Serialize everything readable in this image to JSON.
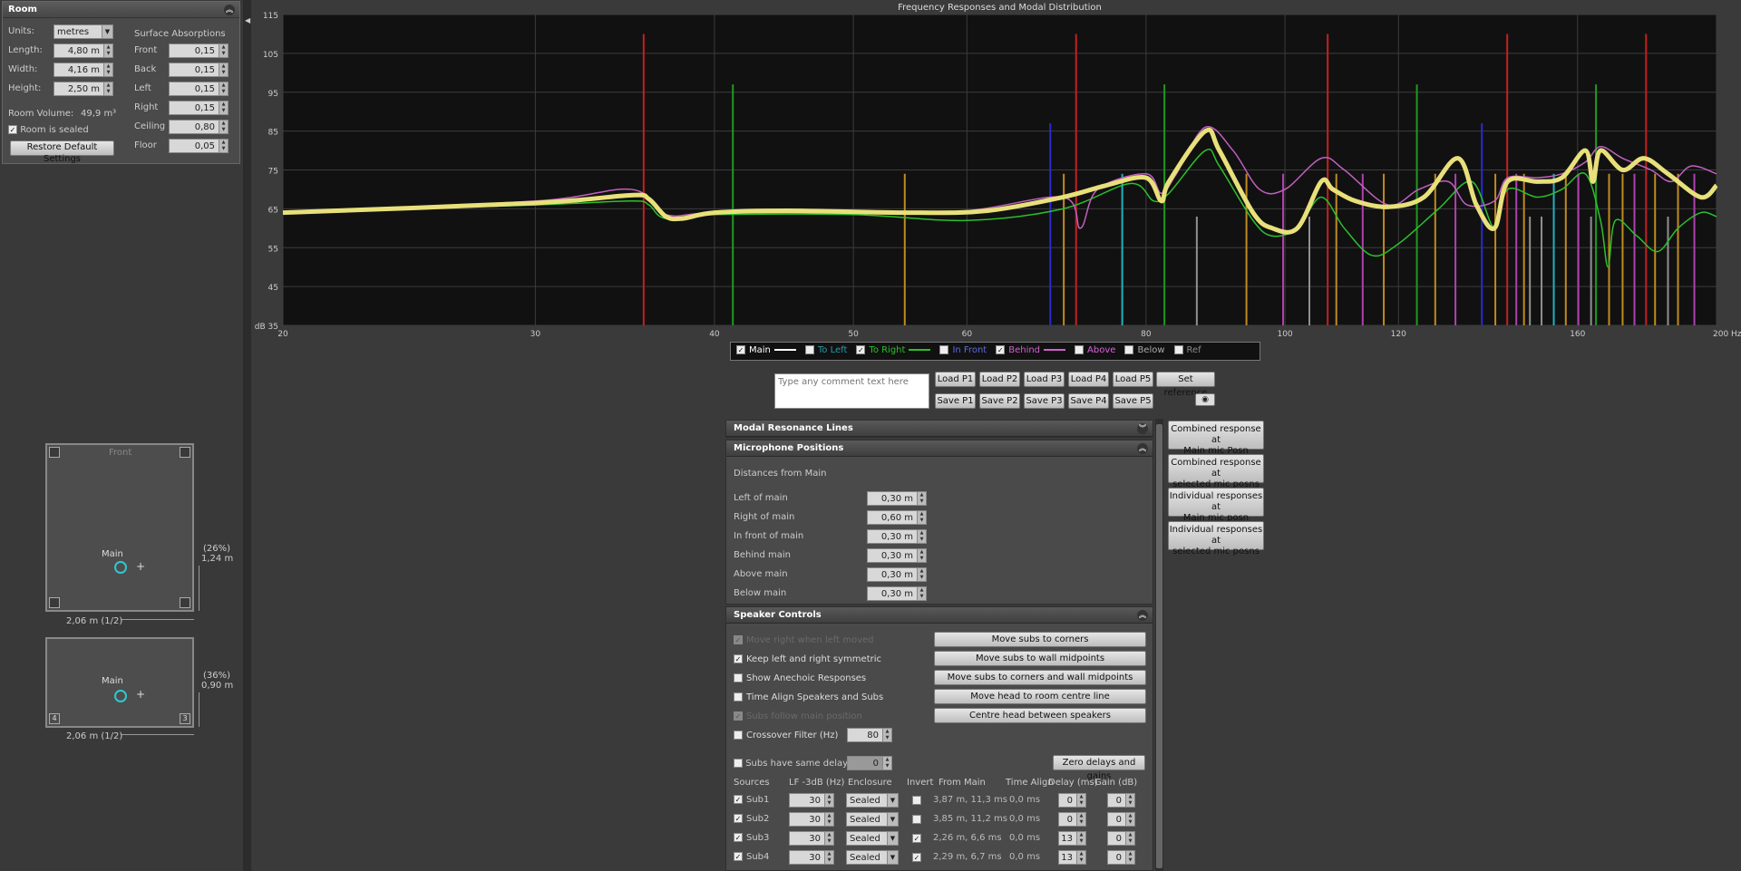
{
  "room": {
    "title": "Room",
    "units_label": "Units:",
    "units_value": "metres",
    "length_label": "Length:",
    "length_value": "4,80 m",
    "width_label": "Width:",
    "width_value": "4,16 m",
    "height_label": "Height:",
    "height_value": "2,50 m",
    "volume_label": "Room Volume:",
    "volume_value": "49,9 m³",
    "sealed_label": "Room is sealed",
    "restore_label": "Restore Default Settings",
    "surface_title": "Surface Absorptions",
    "surfaces": [
      {
        "label": "Front",
        "value": "0,15"
      },
      {
        "label": "Back",
        "value": "0,15"
      },
      {
        "label": "Left",
        "value": "0,15"
      },
      {
        "label": "Right",
        "value": "0,15"
      },
      {
        "label": "Ceiling",
        "value": "0,80"
      },
      {
        "label": "Floor",
        "value": "0,05"
      }
    ]
  },
  "plan_top": {
    "front_label": "Front",
    "main_label": "Main",
    "side_pct": "(26%)",
    "side_dist": "1,24 m",
    "bottom_dist": "2,06 m (1/2)"
  },
  "plan_side": {
    "main_label": "Main",
    "side_pct": "(36%)",
    "side_dist": "0,90 m",
    "bottom_dist": "2,06 m (1/2)",
    "corner_left": "4",
    "corner_right": "3"
  },
  "chart_data": {
    "type": "line",
    "title": "Frequency Responses and Modal Distribution",
    "xscale": "log",
    "xlim": [
      20,
      200
    ],
    "ylim": [
      35,
      115
    ],
    "xticks": [
      "20",
      "30",
      "40",
      "50",
      "60",
      "80",
      "100",
      "120",
      "160",
      "200 Hz"
    ],
    "xtick_values": [
      20,
      30,
      40,
      50,
      60,
      80,
      100,
      120,
      160,
      200
    ],
    "yticks": [
      "115",
      "105",
      "95",
      "85",
      "75",
      "65",
      "55",
      "45",
      "dB 35"
    ],
    "ytick_values": [
      115,
      105,
      95,
      85,
      75,
      65,
      55,
      45,
      35
    ],
    "grid": true,
    "series": [
      {
        "name": "Main",
        "color": "#e8e07a",
        "points": [
          [
            20,
            64
          ],
          [
            30,
            66.5
          ],
          [
            35,
            68.5
          ],
          [
            36,
            67.5
          ],
          [
            37,
            63
          ],
          [
            38,
            62.5
          ],
          [
            40,
            64
          ],
          [
            45,
            64.5
          ],
          [
            55,
            64
          ],
          [
            62,
            64.5
          ],
          [
            70,
            68
          ],
          [
            75,
            71
          ],
          [
            80,
            73
          ],
          [
            82,
            67
          ],
          [
            83,
            72
          ],
          [
            88,
            85
          ],
          [
            90,
            80
          ],
          [
            95,
            64
          ],
          [
            98,
            60
          ],
          [
            102,
            60
          ],
          [
            106,
            72
          ],
          [
            108,
            70
          ],
          [
            112,
            67
          ],
          [
            118,
            65.5
          ],
          [
            125,
            68
          ],
          [
            132,
            78
          ],
          [
            136,
            66
          ],
          [
            140,
            60
          ],
          [
            143,
            72
          ],
          [
            150,
            72
          ],
          [
            156,
            73
          ],
          [
            162,
            80
          ],
          [
            164,
            72
          ],
          [
            166,
            80
          ],
          [
            172,
            75
          ],
          [
            178,
            78
          ],
          [
            185,
            74
          ],
          [
            195,
            68
          ],
          [
            200,
            71
          ]
        ]
      },
      {
        "name": "To Right",
        "color": "#2cc02c",
        "points": [
          [
            20,
            64
          ],
          [
            30,
            66
          ],
          [
            35,
            67
          ],
          [
            36,
            66
          ],
          [
            37,
            62.5
          ],
          [
            40,
            63.5
          ],
          [
            50,
            63.5
          ],
          [
            60,
            62
          ],
          [
            70,
            65
          ],
          [
            78,
            71.5
          ],
          [
            81,
            67
          ],
          [
            83,
            69
          ],
          [
            88,
            80
          ],
          [
            90,
            76
          ],
          [
            95,
            62
          ],
          [
            98,
            58
          ],
          [
            102,
            60
          ],
          [
            106,
            68
          ],
          [
            110,
            60
          ],
          [
            115,
            53
          ],
          [
            120,
            56
          ],
          [
            128,
            65
          ],
          [
            135,
            72
          ],
          [
            140,
            60
          ],
          [
            143,
            70
          ],
          [
            150,
            68
          ],
          [
            156,
            70
          ],
          [
            162,
            74
          ],
          [
            166,
            62
          ],
          [
            168,
            50
          ],
          [
            170,
            62
          ],
          [
            176,
            58
          ],
          [
            182,
            54
          ],
          [
            188,
            60
          ],
          [
            195,
            64
          ],
          [
            200,
            63
          ]
        ]
      },
      {
        "name": "Behind",
        "color": "#c060c0",
        "points": [
          [
            20,
            64
          ],
          [
            30,
            67
          ],
          [
            35,
            70
          ],
          [
            37,
            63.5
          ],
          [
            40,
            64
          ],
          [
            50,
            64
          ],
          [
            60,
            64.5
          ],
          [
            70,
            68
          ],
          [
            72,
            60
          ],
          [
            74,
            70
          ],
          [
            80,
            74
          ],
          [
            82,
            69
          ],
          [
            84,
            74
          ],
          [
            88,
            86
          ],
          [
            92,
            80
          ],
          [
            96,
            70
          ],
          [
            100,
            70
          ],
          [
            106,
            78
          ],
          [
            110,
            75
          ],
          [
            118,
            66
          ],
          [
            124,
            70
          ],
          [
            130,
            72
          ],
          [
            134,
            66
          ],
          [
            140,
            67
          ],
          [
            143,
            73
          ],
          [
            150,
            73
          ],
          [
            156,
            74
          ],
          [
            162,
            77
          ],
          [
            166,
            81
          ],
          [
            172,
            78
          ],
          [
            180,
            75
          ],
          [
            186,
            72
          ],
          [
            192,
            76
          ],
          [
            200,
            74
          ]
        ]
      }
    ],
    "mode_lines": [
      {
        "f": 35.7,
        "color": "#c42020",
        "top": 110
      },
      {
        "f": 71.5,
        "color": "#c42020",
        "top": 110
      },
      {
        "f": 107.1,
        "color": "#c42020",
        "top": 110
      },
      {
        "f": 142.9,
        "color": "#c42020",
        "top": 110
      },
      {
        "f": 178.6,
        "color": "#c42020",
        "top": 110
      },
      {
        "f": 41.2,
        "color": "#1f9a1f",
        "top": 97
      },
      {
        "f": 82.4,
        "color": "#1f9a1f",
        "top": 97
      },
      {
        "f": 123.6,
        "color": "#1f9a1f",
        "top": 97
      },
      {
        "f": 164.8,
        "color": "#1f9a1f",
        "top": 97
      },
      {
        "f": 54.3,
        "color": "#c08a20",
        "top": 74
      },
      {
        "f": 70.1,
        "color": "#c08a20",
        "top": 74
      },
      {
        "f": 94.0,
        "color": "#c08a20",
        "top": 74
      },
      {
        "f": 108.6,
        "color": "#c08a20",
        "top": 74
      },
      {
        "f": 117.2,
        "color": "#c08a20",
        "top": 74
      },
      {
        "f": 127.3,
        "color": "#c08a20",
        "top": 74
      },
      {
        "f": 140.2,
        "color": "#c08a20",
        "top": 74
      },
      {
        "f": 146.8,
        "color": "#c08a20",
        "top": 74
      },
      {
        "f": 157.0,
        "color": "#c08a20",
        "top": 74
      },
      {
        "f": 168.3,
        "color": "#c08a20",
        "top": 74
      },
      {
        "f": 172.0,
        "color": "#c08a20",
        "top": 74
      },
      {
        "f": 181.2,
        "color": "#c08a20",
        "top": 74
      },
      {
        "f": 188.0,
        "color": "#c08a20",
        "top": 74
      },
      {
        "f": 68.6,
        "color": "#2a2ad0",
        "top": 87
      },
      {
        "f": 137.2,
        "color": "#2a2ad0",
        "top": 87
      },
      {
        "f": 77.0,
        "color": "#20b0c0",
        "top": 74
      },
      {
        "f": 154.0,
        "color": "#20b0c0",
        "top": 74
      },
      {
        "f": 99.7,
        "color": "#b040b0",
        "top": 74
      },
      {
        "f": 113.3,
        "color": "#b040b0",
        "top": 74
      },
      {
        "f": 131.5,
        "color": "#b040b0",
        "top": 74
      },
      {
        "f": 145.0,
        "color": "#b040b0",
        "top": 74
      },
      {
        "f": 160.2,
        "color": "#b040b0",
        "top": 74
      },
      {
        "f": 175.3,
        "color": "#b040b0",
        "top": 74
      },
      {
        "f": 193.0,
        "color": "#b040b0",
        "top": 74
      },
      {
        "f": 86.8,
        "color": "#909090",
        "top": 63
      },
      {
        "f": 104.0,
        "color": "#909090",
        "top": 63
      },
      {
        "f": 148.2,
        "color": "#909090",
        "top": 63
      },
      {
        "f": 151.0,
        "color": "#909090",
        "top": 63
      },
      {
        "f": 163.5,
        "color": "#909090",
        "top": 63
      },
      {
        "f": 185.0,
        "color": "#909090",
        "top": 63
      }
    ]
  },
  "legend": [
    {
      "label": "Main",
      "checked": true,
      "color": "#ffffff",
      "line": true
    },
    {
      "label": "To Left",
      "checked": false,
      "color": "#2a9aaa",
      "line": false
    },
    {
      "label": "To Right",
      "checked": true,
      "color": "#2cc02c",
      "line": true
    },
    {
      "label": "In Front",
      "checked": false,
      "color": "#5a6ae0",
      "line": false
    },
    {
      "label": "Behind",
      "checked": true,
      "color": "#d060d0",
      "line": true
    },
    {
      "label": "Above",
      "checked": false,
      "color": "#e060e0",
      "line": false
    },
    {
      "label": "Below",
      "checked": false,
      "color": "#aaaaaa",
      "line": false
    },
    {
      "label": "Ref",
      "checked": false,
      "color": "#888888",
      "line": false
    }
  ],
  "comment_placeholder": "Type any comment text here",
  "load_buttons": [
    "Load P1",
    "Load P2",
    "Load P3",
    "Load P4",
    "Load P5"
  ],
  "save_buttons": [
    "Save P1",
    "Save P2",
    "Save P3",
    "Save P4",
    "Save P5"
  ],
  "set_reference": "Set reference",
  "modal_panel_title": "Modal Resonance Lines",
  "mic_panel": {
    "title": "Microphone Positions",
    "subtitle": "Distances from Main",
    "rows": [
      {
        "label": "Left of main",
        "value": "0,30 m"
      },
      {
        "label": "Right of main",
        "value": "0,60 m"
      },
      {
        "label": "In front of main",
        "value": "0,30 m"
      },
      {
        "label": "Behind main",
        "value": "0,30 m"
      },
      {
        "label": "Above main",
        "value": "0,30 m"
      },
      {
        "label": "Below main",
        "value": "0,30 m"
      }
    ]
  },
  "side_buttons": [
    "Combined response at\nMain mic Posn",
    "Combined response at\nselected mic posns",
    "Individual responses at\nMain mic posn",
    "Individual responses at\nselected mic posns"
  ],
  "speaker_panel": {
    "title": "Speaker Controls",
    "checks": [
      {
        "label": "Move right when left moved",
        "checked": true,
        "disabled": true
      },
      {
        "label": "Keep left and right symmetric",
        "checked": true,
        "disabled": false
      },
      {
        "label": "Show Anechoic Responses",
        "checked": false,
        "disabled": false
      },
      {
        "label": "Time Align Speakers and Subs",
        "checked": false,
        "disabled": false
      },
      {
        "label": "Subs follow main position",
        "checked": true,
        "disabled": true
      },
      {
        "label": "Crossover Filter (Hz)",
        "checked": false,
        "disabled": false
      }
    ],
    "crossover_value": "80",
    "action_buttons": [
      "Move subs to corners",
      "Move subs to wall midpoints",
      "Move subs to corners and wall midpoints",
      "Move head to room centre line",
      "Centre head between speakers"
    ],
    "same_delay_label": "Subs have same delay",
    "same_delay_value": "0",
    "zero_button": "Zero delays and gains",
    "columns": [
      "Sources",
      "LF -3dB (Hz)",
      "Enclosure",
      "Invert",
      "From Main",
      "Time Align",
      "Delay (ms)",
      "Gain (dB)"
    ],
    "subs": [
      {
        "name": "Sub1",
        "lf": "30",
        "enc": "Sealed",
        "invert": false,
        "from": "3,87 m, 11,3 ms",
        "align": "0,0 ms",
        "delay": "0",
        "gain": "0"
      },
      {
        "name": "Sub2",
        "lf": "30",
        "enc": "Sealed",
        "invert": false,
        "from": "3,85 m, 11,2 ms",
        "align": "0,0 ms",
        "delay": "0",
        "gain": "0"
      },
      {
        "name": "Sub3",
        "lf": "30",
        "enc": "Sealed",
        "invert": true,
        "from": "2,26 m, 6,6 ms",
        "align": "0,0 ms",
        "delay": "13",
        "gain": "0"
      },
      {
        "name": "Sub4",
        "lf": "30",
        "enc": "Sealed",
        "invert": true,
        "from": "2,29 m, 6,7 ms",
        "align": "0,0 ms",
        "delay": "13",
        "gain": "0"
      }
    ]
  }
}
